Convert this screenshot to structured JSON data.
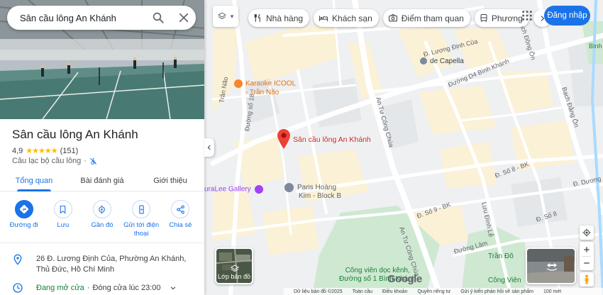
{
  "search": {
    "value": "Sân cầu lông An Khánh"
  },
  "place": {
    "title": "Sân cầu lông An Khánh",
    "rating": "4,9",
    "review_count": "(151)",
    "category": "Câu lạc bộ cầu lông",
    "category_sep": "·"
  },
  "tabs": [
    {
      "label": "Tổng quan"
    },
    {
      "label": "Bài đánh giá"
    },
    {
      "label": "Giới thiệu"
    }
  ],
  "actions": [
    {
      "label": "Đường đi"
    },
    {
      "label": "Lưu"
    },
    {
      "label": "Gần đó"
    },
    {
      "label": "Gửi tới điện thoại"
    },
    {
      "label": "Chia sẻ"
    }
  ],
  "address": "26 Đ. Lương Định Của, Phường An Khánh, Thủ Đức, Hồ Chí Minh",
  "hours": {
    "status": "Đang mở cửa",
    "sep": "·",
    "close": "Đóng cửa lúc 23:00"
  },
  "map_chips": [
    {
      "label": "Nhà hàng"
    },
    {
      "label": "Khách sạn"
    },
    {
      "label": "Điểm tham quan"
    },
    {
      "label": "Phương"
    }
  ],
  "signin": "Đăng nhập",
  "layers_label": "Lớp bản đồ",
  "map_labels": {
    "pin": "Sân cầu lông An Khánh",
    "karaoke": "Karaoke ICOOL",
    "karaoke_2": "- Trần Não",
    "paris": "Paris Hoàng",
    "paris_2": "Kim - Block B",
    "gallery": "uraLee Gallery",
    "decapella": "de Capella",
    "park_1": "Công viên dọc kênh,",
    "park_2": "Đường số 1 Bình Khánh",
    "park_3": "Công Viên",
    "park_4": "Trần Đô",
    "binh": "Bình",
    "google": "Google"
  },
  "road_labels": {
    "tran_nao": "Trần Não",
    "duong_so_18": "Đường số 18",
    "an_tu_cong_chua": "An Tư Công Chúa",
    "an_tu_cong_chua_2": "An Tư Công Chúa",
    "luong_dinh_cua": "Đ. Lương Định Của",
    "d4_binh_khanh": "Đường D4 Bình Khánh",
    "bach_dong_on": "Bạch Đồng Ôn",
    "bach_dong_on_2": "Bạch Đằng Ôn",
    "so8_bk": "Đ. Số 8 - BK",
    "so9_bk": "Đ. Số 9 - BK",
    "luu_dinh_le": "Lưu Đình Lễ",
    "duong_lam": "Đường Lâm",
    "d_so_8": "Đ. Số 8",
    "d_duong": "Đ. Dương"
  },
  "footer": [
    "Dữ liệu bản đồ ©2025",
    "Toàn cầu",
    "Điều khoản",
    "Quyền riêng tư",
    "Gửi ý kiến phản hồi về sản phẩm",
    "100 mét"
  ],
  "colors": {
    "accent": "#1a73e8",
    "pin": "#ea4335",
    "open": "#188038",
    "stars": "#fbbc04"
  }
}
